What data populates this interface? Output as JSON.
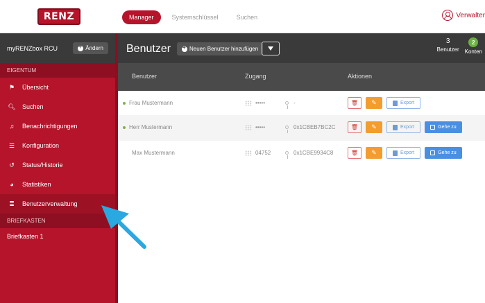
{
  "header": {
    "logo": "RENZ",
    "nav": [
      "Manager",
      "Systemschlüssel",
      "Suchen"
    ],
    "user_label": "Verwalter"
  },
  "sidebar": {
    "title": "myRENZbox RCU",
    "aendern_label": "Ändern",
    "section_eigentum": "EIGENTUM",
    "items": [
      {
        "label": "Übersicht",
        "icon": "flag-icon"
      },
      {
        "label": "Suchen",
        "icon": "search-icon"
      },
      {
        "label": "Benachrichtigungen",
        "icon": "bell-icon"
      },
      {
        "label": "Konfiguration",
        "icon": "sliders-icon"
      },
      {
        "label": "Status/Historie",
        "icon": "history-icon"
      },
      {
        "label": "Statistiken",
        "icon": "pie-chart-icon"
      },
      {
        "label": "Benutzerverwaltung",
        "icon": "list-icon"
      }
    ],
    "section_briefkasten": "BRIEFKASTEN",
    "briefkasten_items": [
      "Briefkasten 1"
    ]
  },
  "main": {
    "title": "Benutzer",
    "add_label": "Neuen Benutzer hinzufügen",
    "count_benutzer": "3",
    "label_benutzer": "Benutzer",
    "count_konten": "2",
    "label_konten": "Konten",
    "columns": [
      "Benutzer",
      "Zugang",
      "Aktionen"
    ],
    "rows": [
      {
        "name": "Frau Mustermann",
        "code": "•••••",
        "key": "-",
        "active": true,
        "gehe": false
      },
      {
        "name": "Herr Mustermann",
        "code": "•••••",
        "key": "0x1CBEB7BC2C",
        "active": true,
        "gehe": true
      },
      {
        "name": "Max Mustermann",
        "code": "04752",
        "key": "0x1CBE9934C8",
        "active": false,
        "gehe": true
      }
    ],
    "export_label": "Export",
    "gehe_label": "Gehe zu"
  },
  "colors": {
    "brand": "#b5142b",
    "sidebar_dark": "#8e0f22",
    "header_dark": "#3a3a3a",
    "status_green": "#7cb342",
    "edit_orange": "#f39c2f",
    "link_blue": "#4a90e2",
    "arrow": "#2aa8e0"
  }
}
